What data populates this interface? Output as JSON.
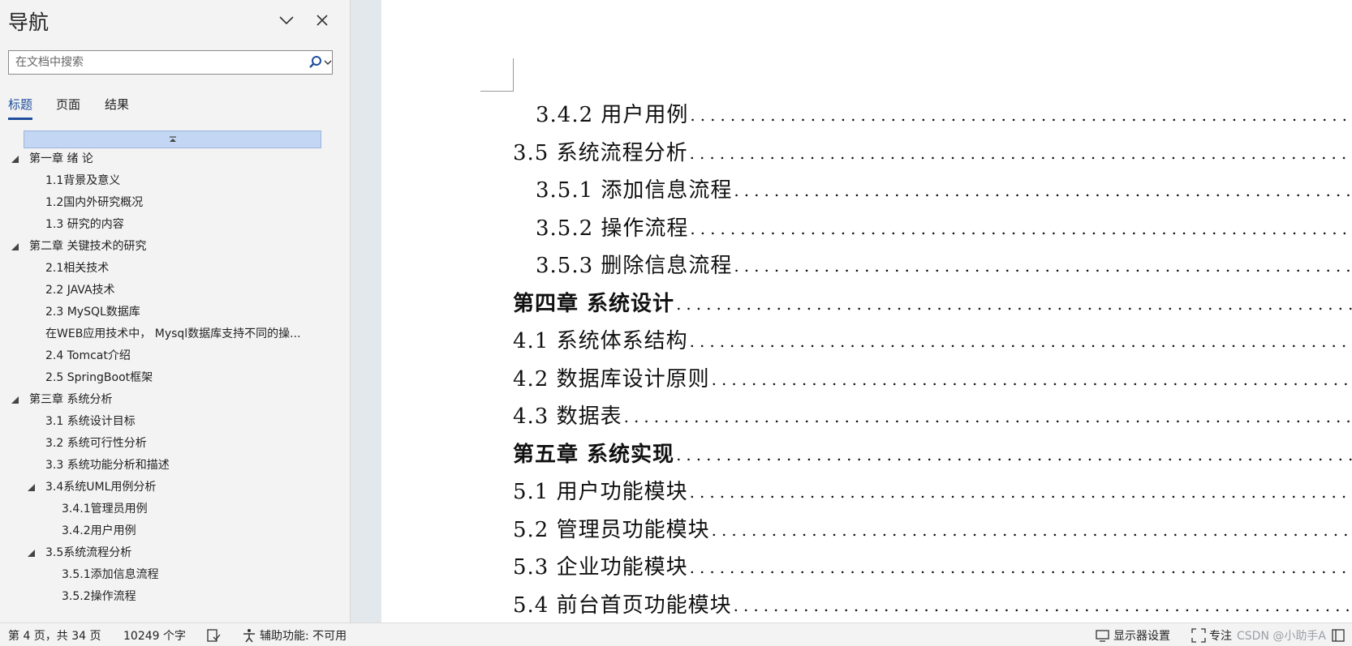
{
  "nav": {
    "title": "导航",
    "search_placeholder": "在文档中搜索",
    "tabs": [
      {
        "label": "标题"
      },
      {
        "label": "页面"
      },
      {
        "label": "结果"
      }
    ],
    "outline": [
      {
        "label": "第一章 绪 论",
        "level": 1,
        "expanded": true
      },
      {
        "label": "1.1背景及意义",
        "level": 2
      },
      {
        "label": "1.2国内外研究概况",
        "level": 2
      },
      {
        "label": "1.3 研究的内容",
        "level": 2
      },
      {
        "label": "第二章 关键技术的研究",
        "level": 1,
        "expanded": true
      },
      {
        "label": "2.1相关技术",
        "level": 2
      },
      {
        "label": "2.2 JAVA技术",
        "level": 2
      },
      {
        "label": "2.3 MySQL数据库",
        "level": 2
      },
      {
        "label": "在WEB应用技术中， Mysql数据库支持不同的操...",
        "level": 2
      },
      {
        "label": "2.4 Tomcat介绍",
        "level": 2
      },
      {
        "label": "2.5 SpringBoot框架",
        "level": 2
      },
      {
        "label": "第三章 系统分析",
        "level": 1,
        "expanded": true
      },
      {
        "label": "3.1 系统设计目标",
        "level": 2
      },
      {
        "label": "3.2 系统可行性分析",
        "level": 2
      },
      {
        "label": "3.3 系统功能分析和描述",
        "level": 2
      },
      {
        "label": "3.4系统UML用例分析",
        "level": 2,
        "expanded": true
      },
      {
        "label": "3.4.1管理员用例",
        "level": 3
      },
      {
        "label": "3.4.2用户用例",
        "level": 3
      },
      {
        "label": "3.5系统流程分析",
        "level": 2,
        "expanded": true
      },
      {
        "label": "3.5.1添加信息流程",
        "level": 3
      },
      {
        "label": "3.5.2操作流程",
        "level": 3
      }
    ]
  },
  "document": {
    "toc": [
      {
        "text": "3.4.2 用户用例",
        "indent": 1,
        "bold": false
      },
      {
        "text": "3.5 系统流程分析",
        "indent": 0,
        "bold": false
      },
      {
        "text": "3.5.1 添加信息流程",
        "indent": 1,
        "bold": false
      },
      {
        "text": "3.5.2 操作流程",
        "indent": 1,
        "bold": false
      },
      {
        "text": "3.5.3 删除信息流程",
        "indent": 1,
        "bold": false
      },
      {
        "text": "第四章  系统设计",
        "indent": 0,
        "bold": true
      },
      {
        "text": "4.1  系统体系结构",
        "indent": 0,
        "bold": false
      },
      {
        "text": "4.2  数据库设计原则",
        "indent": 0,
        "bold": false
      },
      {
        "text": "4.3  数据表",
        "indent": 0,
        "bold": false
      },
      {
        "text": "第五章  系统实现",
        "indent": 0,
        "bold": true
      },
      {
        "text": "5.1 用户功能模块",
        "indent": 0,
        "bold": false
      },
      {
        "text": "5.2 管理员功能模块",
        "indent": 0,
        "bold": false
      },
      {
        "text": "5.3 企业功能模块",
        "indent": 0,
        "bold": false
      },
      {
        "text": "5.4 前台首页功能模块",
        "indent": 0,
        "bold": false
      }
    ]
  },
  "status": {
    "page": "第 4 页，共 34 页",
    "words": "10249 个字",
    "accessibility": "辅助功能: 不可用",
    "display_settings": "显示器设置",
    "focus": "专注",
    "watermark": "CSDN @小助手A"
  },
  "colors": {
    "accent": "#1e4e9d",
    "collapse_bar": "#c3d6f3"
  },
  "icons": [
    "chevron-down-icon",
    "close-icon",
    "search-icon",
    "collapse-all-icon",
    "expand-triangle-icon",
    "proofing-icon",
    "accessibility-icon",
    "display-settings-icon",
    "focus-icon",
    "view-layout-icon"
  ]
}
